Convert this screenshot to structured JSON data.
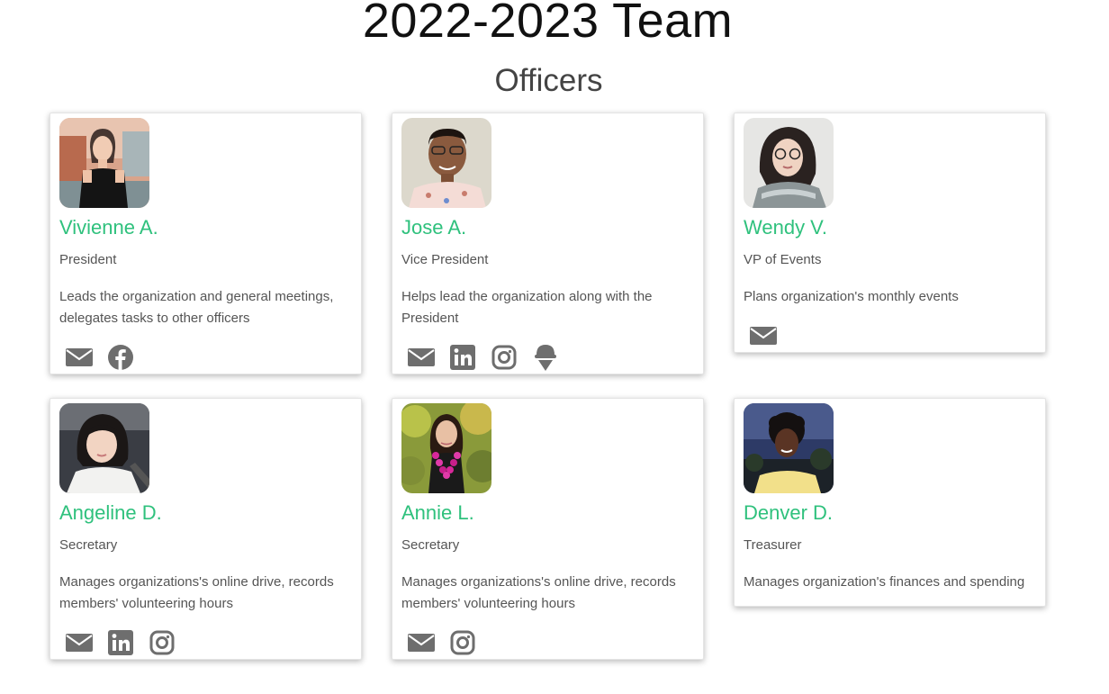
{
  "page": {
    "title": "2022-2023 Team",
    "section": "Officers"
  },
  "colors": {
    "name_green": "#2fc17d",
    "icon_gray": "#6e6e6e",
    "text_gray": "#555555"
  },
  "officers": [
    {
      "name": "Vivienne A.",
      "role": "President",
      "description": "Leads the organization and general meetings, delegates tasks to other officers",
      "links": [
        "email-icon",
        "facebook-icon"
      ]
    },
    {
      "name": "Jose A.",
      "role": "Vice President",
      "description": "Helps lead the organization along with the President",
      "links": [
        "email-icon",
        "linkedin-icon",
        "instagram-icon",
        "ice-cream-icon"
      ]
    },
    {
      "name": "Wendy V.",
      "role": "VP of Events",
      "description": "Plans organization's monthly events",
      "links": [
        "email-icon"
      ]
    },
    {
      "name": "Angeline D.",
      "role": "Secretary",
      "description": "Manages organizations's online drive, records members' volunteering hours",
      "links": [
        "email-icon",
        "linkedin-icon",
        "instagram-icon"
      ]
    },
    {
      "name": "Annie L.",
      "role": "Secretary",
      "description": "Manages organizations's online drive, records members' volunteering hours",
      "links": [
        "email-icon",
        "instagram-icon"
      ]
    },
    {
      "name": "Denver D.",
      "role": "Treasurer",
      "description": "Manages organization's finances and spending",
      "links": [
        "email-icon"
      ]
    }
  ]
}
